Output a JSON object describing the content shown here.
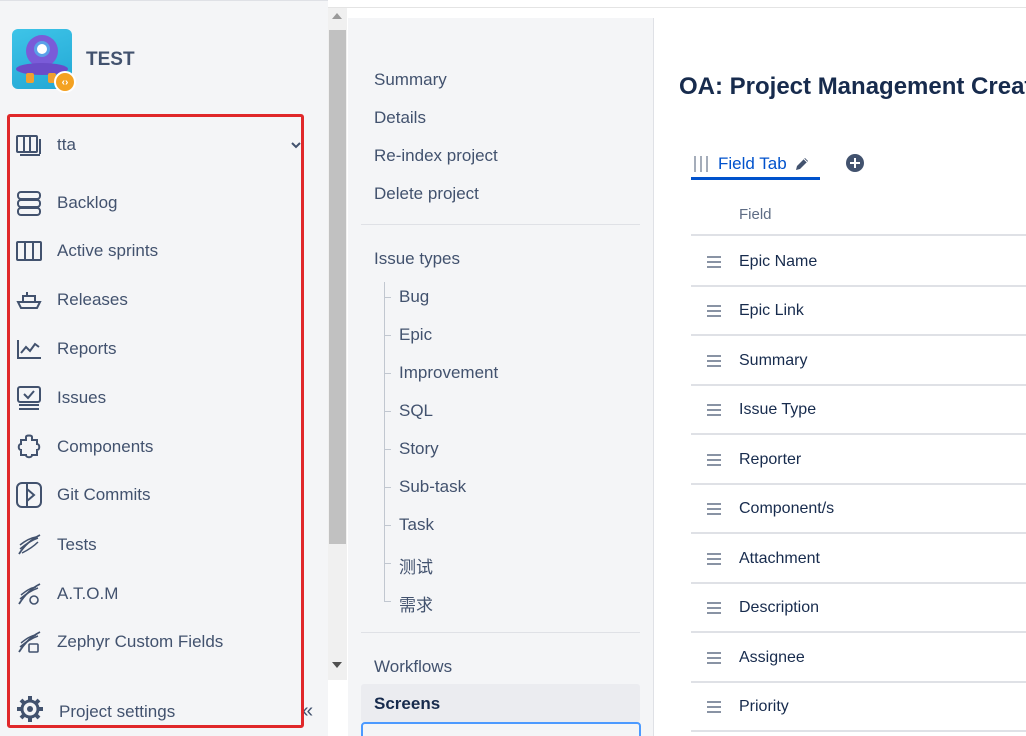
{
  "project": {
    "name": "TEST",
    "badge_glyph": "‹›"
  },
  "sidebar": {
    "board_select": {
      "label": "tta"
    },
    "items": [
      {
        "label": "Backlog",
        "icon": "backlog-icon"
      },
      {
        "label": "Active sprints",
        "icon": "active-sprints-icon"
      },
      {
        "label": "Releases",
        "icon": "releases-icon"
      },
      {
        "label": "Reports",
        "icon": "reports-icon"
      },
      {
        "label": "Issues",
        "icon": "issues-icon"
      },
      {
        "label": "Components",
        "icon": "components-icon"
      },
      {
        "label": "Git Commits",
        "icon": "git-commits-icon"
      },
      {
        "label": "Tests",
        "icon": "tests-icon"
      },
      {
        "label": "A.T.O.M",
        "icon": "atom-icon"
      },
      {
        "label": "Zephyr Custom Fields",
        "icon": "zephyr-icon"
      }
    ],
    "settings_label": "Project settings",
    "collapse_glyph": "«"
  },
  "settings_nav": {
    "top_links": [
      "Summary",
      "Details",
      "Re-index project",
      "Delete project"
    ],
    "issue_types_label": "Issue types",
    "issue_types": [
      "Bug",
      "Epic",
      "Improvement",
      "SQL",
      "Story",
      "Sub-task",
      "Task",
      "测试",
      "需求"
    ],
    "workflows_label": "Workflows",
    "screens_label": "Screens"
  },
  "main": {
    "title": "OA: Project Management Creat",
    "tab_label": "Field Tab",
    "column_header": "Field",
    "fields": [
      "Epic Name",
      "Epic Link",
      "Summary",
      "Issue Type",
      "Reporter",
      "Component/s",
      "Attachment",
      "Description",
      "Assignee",
      "Priority"
    ]
  },
  "colors": {
    "highlight": "#e0282a",
    "accent": "#0052cc",
    "text": "#42526e"
  }
}
